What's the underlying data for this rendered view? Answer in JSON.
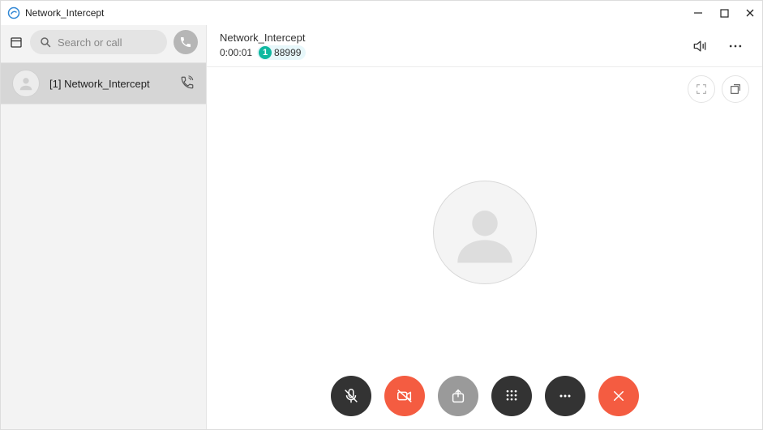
{
  "window": {
    "title": "Network_Intercept"
  },
  "sidebar": {
    "search_placeholder": "Search or call",
    "contact": {
      "label": "[1] Network_Intercept"
    }
  },
  "call": {
    "name": "Network_Intercept",
    "timer": "0:00:01",
    "badge": "1",
    "number": "88999"
  },
  "icons": {
    "app": "app-icon",
    "minimize": "minimize-icon",
    "maximize": "maximize-icon",
    "close": "close-icon",
    "calendar": "calendar-icon",
    "search": "search-icon",
    "dial": "phone-icon",
    "contact_call": "phone-active-icon",
    "speaker": "speaker-icon",
    "more": "more-icon",
    "fullscreen": "fullscreen-icon",
    "popout": "popout-icon",
    "avatar": "person-icon",
    "mic_off": "mic-off-icon",
    "video_off": "video-off-icon",
    "share": "share-icon",
    "dialpad": "dialpad-icon",
    "overflow": "overflow-icon",
    "hangup": "hangup-icon"
  }
}
